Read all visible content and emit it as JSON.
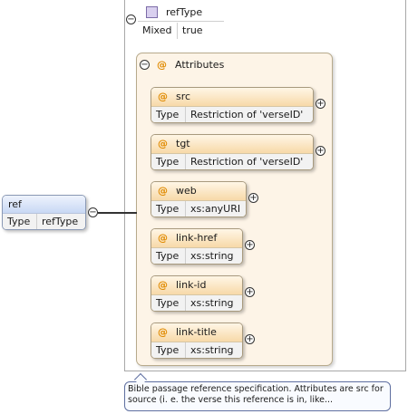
{
  "complex_type": {
    "name": "refType",
    "properties": [
      {
        "key": "Mixed",
        "value": "true"
      }
    ]
  },
  "attributes_group": {
    "label": "Attributes"
  },
  "attributes": [
    {
      "name": "src",
      "type_key": "Type",
      "type_value": "Restriction of 'verseID'"
    },
    {
      "name": "tgt",
      "type_key": "Type",
      "type_value": "Restriction of 'verseID'"
    },
    {
      "name": "web",
      "type_key": "Type",
      "type_value": "xs:anyURI"
    },
    {
      "name": "link-href",
      "type_key": "Type",
      "type_value": "xs:string"
    },
    {
      "name": "link-id",
      "type_key": "Type",
      "type_value": "xs:string"
    },
    {
      "name": "link-title",
      "type_key": "Type",
      "type_value": "xs:string"
    }
  ],
  "element": {
    "name": "ref",
    "type_key": "Type",
    "type_value": "refType"
  },
  "annotation": {
    "line1": "Bible passage reference specification. Attributes are src for",
    "line2": "source (i. e. the verse this reference is in, like..."
  },
  "symbols": {
    "attribute_marker": "@",
    "collapse": "−",
    "expand": "+"
  },
  "colors": {
    "attribute_marker": "#e08a00",
    "attribute_header": "#f7d9a8",
    "attributes_panel": "#fdf4e7",
    "element_header": "#c8d8f4",
    "type_icon": "#d9d0ef"
  }
}
